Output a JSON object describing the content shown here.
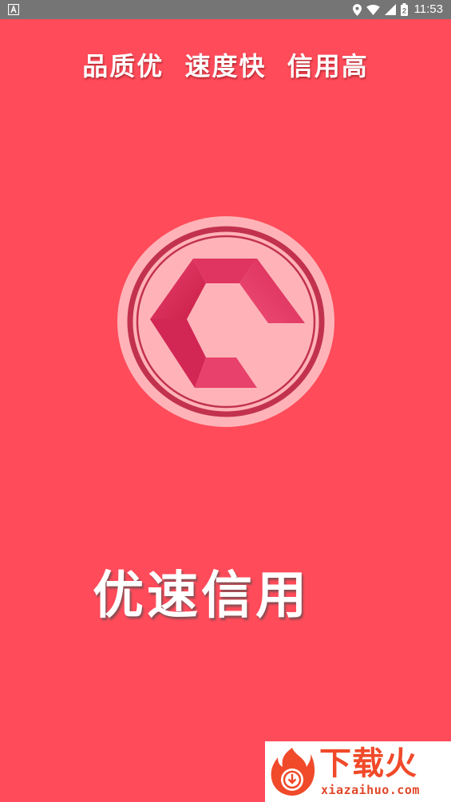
{
  "status_bar": {
    "time": "11:53",
    "battery_level_text": "2"
  },
  "splash": {
    "slogan": "品质优  速度快  信用高",
    "app_name": "优速信用"
  },
  "watermark": {
    "title": "下载火",
    "url": "xiazaihuo.com"
  },
  "colors": {
    "background": "#ff4b5a",
    "status_bar": "#757575",
    "logo_outer": "#ffb3b8",
    "logo_ring": "#c2324e",
    "logo_shape": "#de2c5a",
    "watermark_accent": "#f04a2a"
  }
}
